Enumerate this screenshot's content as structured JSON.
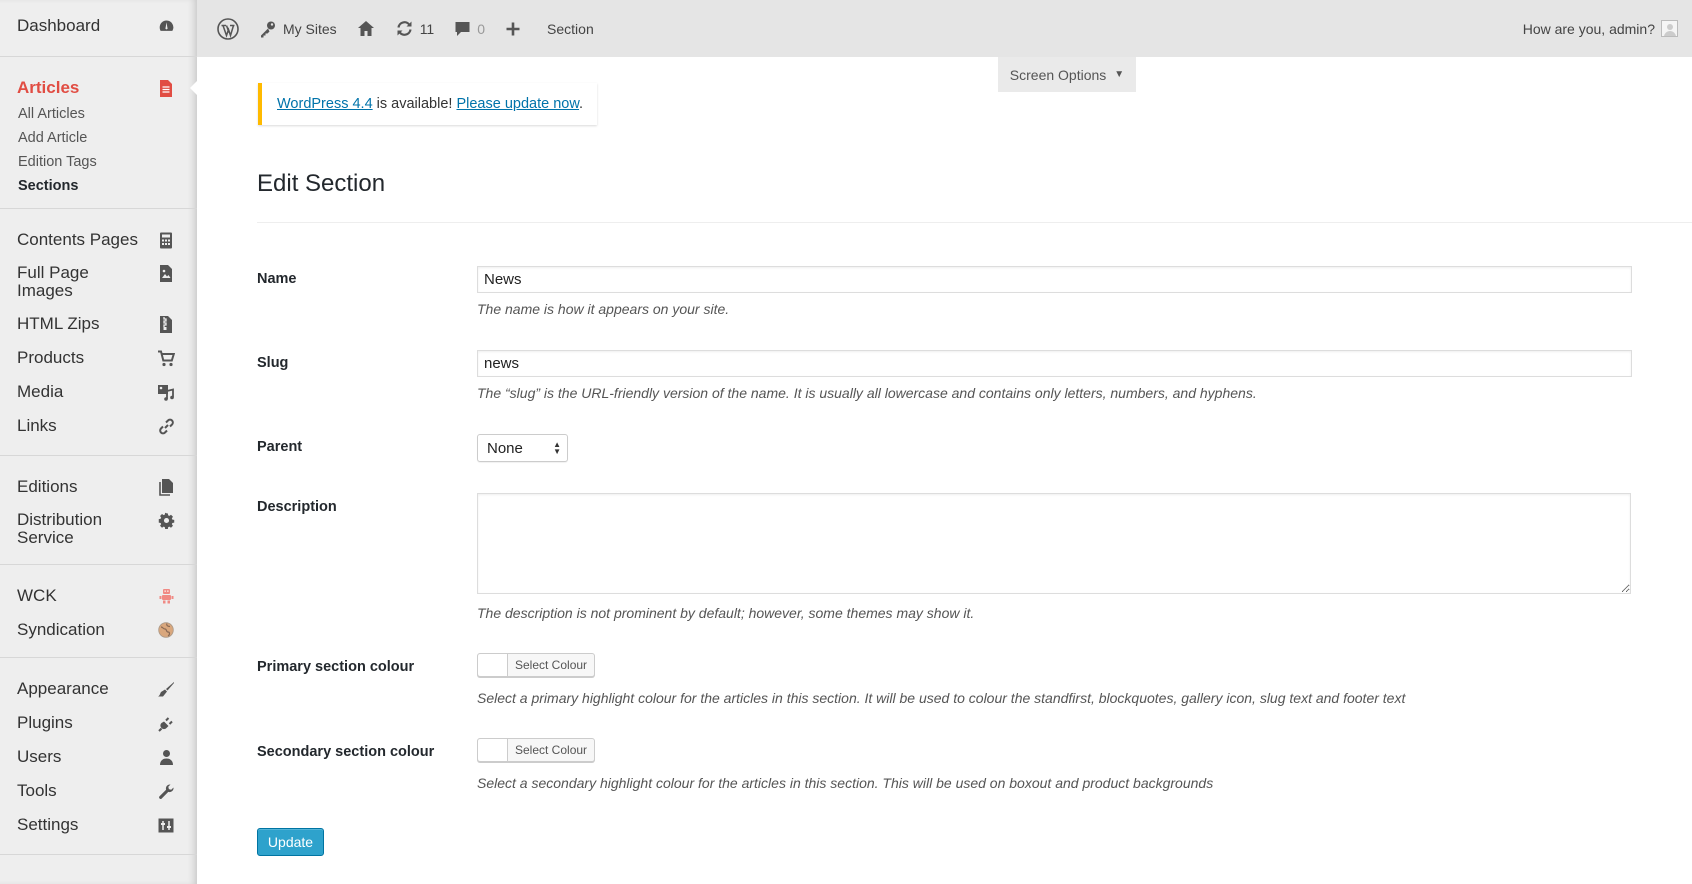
{
  "sidebar": {
    "dashboard": {
      "label": "Dashboard",
      "icon": "dashboard-icon"
    },
    "articles": {
      "label": "Articles",
      "icon": "document-icon"
    },
    "articles_sub": [
      "All Articles",
      "Add Article",
      "Edition Tags",
      "Sections"
    ],
    "group2": [
      {
        "label": "Contents Pages",
        "icon": "calculator-icon"
      },
      {
        "label": "Full Page Images",
        "icon": "image-document-icon"
      },
      {
        "label": "HTML Zips",
        "icon": "zip-file-icon"
      },
      {
        "label": "Products",
        "icon": "cart-icon"
      },
      {
        "label": "Media",
        "icon": "media-icon"
      },
      {
        "label": "Links",
        "icon": "link-icon"
      }
    ],
    "group3": [
      {
        "label": "Editions",
        "icon": "files-icon"
      },
      {
        "label": "Distribution Service",
        "icon": "gear-icon"
      }
    ],
    "group4": [
      {
        "label": "WCK",
        "icon": "robot-icon"
      },
      {
        "label": "Syndication",
        "icon": "globe-icon"
      }
    ],
    "group5": [
      {
        "label": "Appearance",
        "icon": "brush-icon"
      },
      {
        "label": "Plugins",
        "icon": "plug-icon"
      },
      {
        "label": "Users",
        "icon": "user-icon"
      },
      {
        "label": "Tools",
        "icon": "wrench-icon"
      },
      {
        "label": "Settings",
        "icon": "sliders-icon"
      }
    ]
  },
  "topbar": {
    "my_sites": "My Sites",
    "updates_count": "11",
    "comments_count": "0",
    "section": "Section",
    "greeting": "How are you, admin?"
  },
  "screen_options": {
    "label": "Screen Options",
    "caret": "▼"
  },
  "notice": {
    "link1": "WordPress 4.4",
    "middle": " is available! ",
    "link2": "Please update now",
    "end": "."
  },
  "page_title": "Edit Section",
  "form": {
    "name": {
      "label": "Name",
      "value": "News",
      "description": "The name is how it appears on your site."
    },
    "slug": {
      "label": "Slug",
      "value": "news",
      "description": "The “slug” is the URL-friendly version of the name. It is usually all lowercase and contains only letters, numbers, and hyphens."
    },
    "parent": {
      "label": "Parent",
      "selected": "None"
    },
    "description": {
      "label": "Description",
      "value": "",
      "description": "The description is not prominent by default; however, some themes may show it."
    },
    "primary_colour": {
      "label": "Primary section colour",
      "button": "Select Colour",
      "description": "Select a primary highlight colour for the articles in this section. It will be used to colour the standfirst, blockquotes, gallery icon, slug text and footer text"
    },
    "secondary_colour": {
      "label": "Secondary section colour",
      "button": "Select Colour",
      "description": "Select a secondary highlight colour for the articles in this section. This will be used on boxout and product backgrounds"
    },
    "update_button": "Update"
  },
  "colors": {
    "accent_active": "#e14d43",
    "link": "#0073aa",
    "notice_border": "#ffba00",
    "button_primary": "#2ea2cc"
  }
}
